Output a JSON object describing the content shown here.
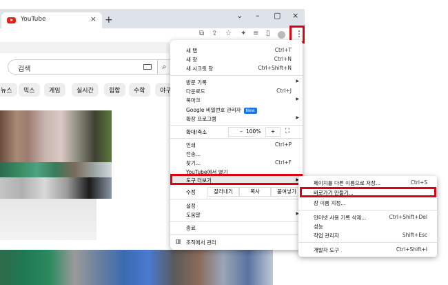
{
  "browser": {
    "tab_title": "YouTube",
    "tab_close": "×",
    "new_tab": "+",
    "window_controls": {
      "minimize": "–",
      "maximize": "▢",
      "close": "×",
      "dropdown": "⌄"
    }
  },
  "page": {
    "search_placeholder": "검색",
    "search_icon": "magnifier-icon",
    "chips": [
      "뉴스",
      "믹스",
      "게임",
      "실시간",
      "힙합",
      "수학",
      "야구"
    ]
  },
  "menu": {
    "new_tab": {
      "label": "새 탭",
      "shortcut": "Ctrl+T"
    },
    "new_window": {
      "label": "새 창",
      "shortcut": "Ctrl+N"
    },
    "incognito": {
      "label": "새 시크릿 창",
      "shortcut": "Ctrl+Shift+N"
    },
    "history": {
      "label": "방문 기록"
    },
    "downloads": {
      "label": "다운로드",
      "shortcut": "Ctrl+J"
    },
    "bookmarks": {
      "label": "북마크"
    },
    "passwords": {
      "label": "Google 비밀번호 관리자",
      "badge": "New"
    },
    "extensions": {
      "label": "확장 프로그램"
    },
    "zoom": {
      "label": "확대/축소",
      "minus": "–",
      "value": "100%",
      "plus": "+"
    },
    "print": {
      "label": "인쇄",
      "shortcut": "Ctrl+P"
    },
    "cast": {
      "label": "전송..."
    },
    "find": {
      "label": "찾기...",
      "shortcut": "Ctrl+F"
    },
    "open_youtube": {
      "label": "YouTube에서 열기"
    },
    "more_tools": {
      "label": "도구 더보기"
    },
    "edit": {
      "label": "수정",
      "cut": "잘라내기",
      "copy": "복사",
      "paste": "붙여넣기"
    },
    "settings": {
      "label": "설정"
    },
    "help": {
      "label": "도움말"
    },
    "exit": {
      "label": "종료"
    },
    "managed": {
      "label": "조직에서 관리"
    }
  },
  "submenu": {
    "save_as": {
      "label": "페이지를 다른 이름으로 저장...",
      "shortcut": "Ctrl+S"
    },
    "create_shortcut": {
      "label": "바로가기 만들기..."
    },
    "name_window": {
      "label": "창 이름 지정..."
    },
    "clear_data": {
      "label": "인터넷 사용 기록 삭제...",
      "shortcut": "Ctrl+Shift+Del"
    },
    "performance": {
      "label": "성능"
    },
    "task_manager": {
      "label": "작업 관리자",
      "shortcut": "Shift+Esc"
    },
    "devtools": {
      "label": "개발자 도구",
      "shortcut": "Ctrl+Shift+I"
    }
  },
  "colors": {
    "highlight": "#e0000f",
    "accent": "#1a73e8"
  }
}
